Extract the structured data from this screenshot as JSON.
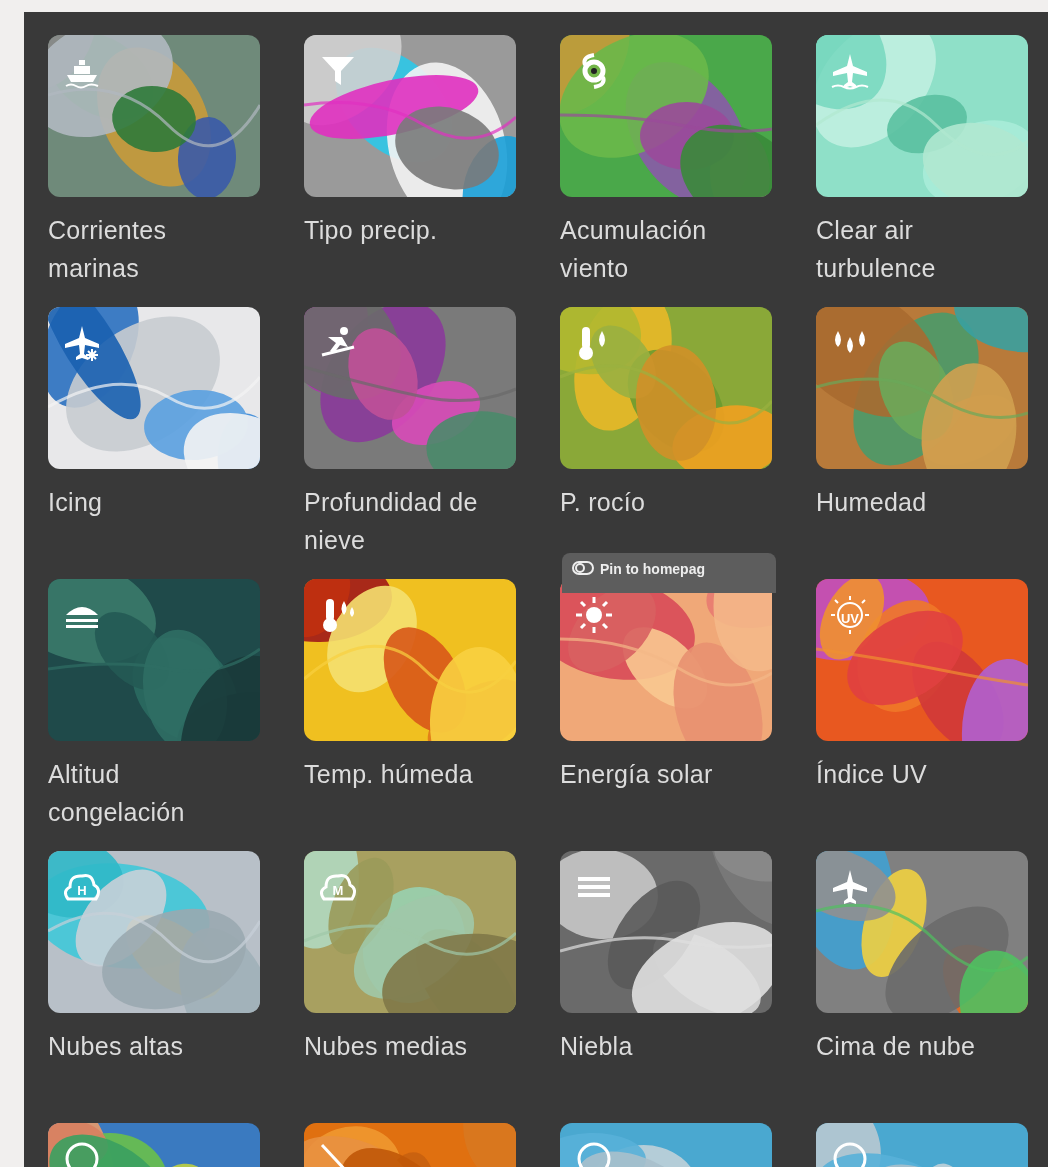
{
  "layers": [
    {
      "label": "Corrientes marinas"
    },
    {
      "label": "Tipo precip."
    },
    {
      "label": "Acumulación viento"
    },
    {
      "label": "Clear air turbulence"
    },
    {
      "label": "Icing"
    },
    {
      "label": "Profundidad de nieve"
    },
    {
      "label": "P. rocío"
    },
    {
      "label": "Humedad"
    },
    {
      "label": "Altitud congelación"
    },
    {
      "label": "Temp. húmeda"
    },
    {
      "label": "Energía solar",
      "tooltip": "Pin to homepag"
    },
    {
      "label": "Índice UV",
      "icon_text": "UV"
    },
    {
      "label": "Nubes altas",
      "icon_text": "H"
    },
    {
      "label": "Nubes medias",
      "icon_text": "M"
    },
    {
      "label": "Niebla"
    },
    {
      "label": "Cima de nube"
    },
    {
      "kind": "picture"
    },
    {
      "kind": "picture"
    },
    {
      "kind": "picture"
    },
    {
      "kind": "picture"
    }
  ]
}
